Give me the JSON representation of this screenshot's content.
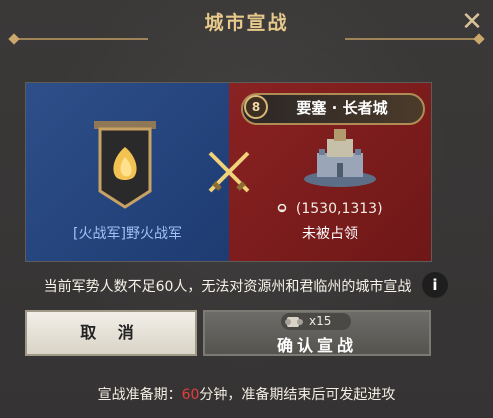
{
  "dialog": {
    "title": "城市宣战",
    "close_icon": "close-icon"
  },
  "attacker": {
    "name": "[火战军]野火战军",
    "banner_icon": "flame-banner-icon",
    "color": "#2e4f8a"
  },
  "target": {
    "level": "8",
    "name": "要塞 · 长者城",
    "coords": "(1530,1313)",
    "status": "未被占领",
    "color": "#8a2222"
  },
  "notice": {
    "text": "当前军势人数不足60人，无法对资源州和君临州的城市宣战",
    "info_icon": "i"
  },
  "buttons": {
    "cancel_label": "取 消",
    "confirm_label": "确认宣战",
    "cost": "x15"
  },
  "footer": {
    "prefix": "宣战准备期：",
    "minutes": "60",
    "suffix": "分钟，准备期结束后可发起进攻",
    "highlight_color": "#e53d3d"
  }
}
